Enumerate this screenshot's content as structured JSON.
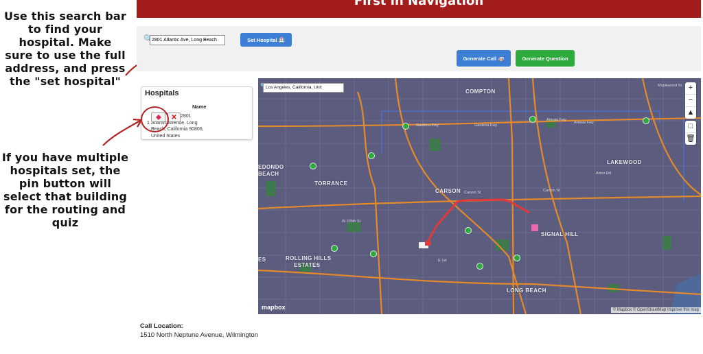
{
  "annotations": {
    "search_tip": "Use this search bar to find your hospital. Make sure to use the full address, and press the \"set hospital\"",
    "pin_tip": "If you have multiple hospitals set, the pin button will select that building for the routing and quiz"
  },
  "header": {
    "title": "First in Navigation",
    "color": "#a31d1d"
  },
  "controls": {
    "address_value": "2801 Atlantic Ave, Long Beach",
    "set_hospital_label": "Set Hospital 🏥",
    "generate_call_label": "Generate Call 🚑",
    "generate_question_label": "Generate Question",
    "colors": {
      "primary": "#3d7fd6",
      "success": "#2eaa3f"
    }
  },
  "hospitals": {
    "title": "Hospitals",
    "column_name": "Name",
    "rows": [
      {
        "index": "1",
        "address": "2801 Atlantic Avenue, Long Beach, California 90806, United States"
      }
    ]
  },
  "map": {
    "search_value": "Los Angeles, California, Unit",
    "city_labels": [
      "COMPTON",
      "LAKEWOOD",
      "CARSON",
      "TORRANCE",
      "SIGNAL HILL",
      "LONG BEACH",
      "ROLLING HILLS",
      "ESTATES",
      "EDONDO",
      "BEACH",
      "ES"
    ],
    "street_labels": [
      "Gardena Fwy",
      "Gardena Fwy",
      "Artesia Fwy",
      "Artesia Fwy",
      "Carson St",
      "Carson St",
      "Arbor Rd",
      "W 235th St",
      "E 1st",
      "Maplewood St"
    ],
    "zoom_in": "+",
    "zoom_out": "−",
    "compass": "▲",
    "draw": "□",
    "trash": "🗑",
    "logo": "mapbox",
    "attribution": "© Mapbox © OpenStreetMap Improve this map",
    "colors": {
      "land": "#5c5d7e",
      "route": "#e03a3a",
      "highway": "#e58a2a",
      "boundary": "#4a73d6"
    }
  },
  "call": {
    "label": "Call Location:",
    "value": "1510 North Neptune Avenue, Wilmington"
  }
}
